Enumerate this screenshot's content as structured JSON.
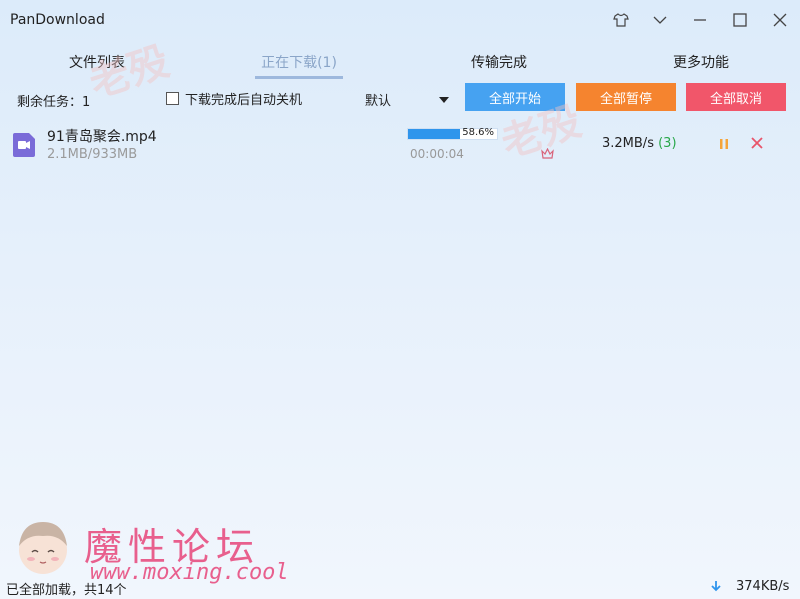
{
  "window": {
    "title": "PanDownload",
    "controls": [
      "skin-icon",
      "chevron-down-icon",
      "minimize-icon",
      "maximize-icon",
      "close-icon"
    ]
  },
  "tabs": [
    {
      "label": "文件列表",
      "active": false
    },
    {
      "label": "正在下载(1)",
      "active": true
    },
    {
      "label": "传输完成",
      "active": false
    },
    {
      "label": "更多功能",
      "active": false
    }
  ],
  "toolbar": {
    "remaining_label": "剩余任务：1",
    "auto_shutdown_label": "下载完成后自动关机",
    "auto_shutdown_checked": false,
    "sort_value": "默认",
    "start_all": "全部开始",
    "pause_all": "全部暂停",
    "cancel_all": "全部取消"
  },
  "download": {
    "file_name": "91青岛聚会.mp4",
    "size": "2.1MB/933MB",
    "progress_percent": 58.6,
    "progress_text": "58.6%",
    "elapsed": "00:00:04",
    "speed": "3.2MB/s",
    "connections": "(3)"
  },
  "status": {
    "text": "已全部加载，共14个",
    "net_speed": "374KB/s"
  },
  "watermark": {
    "text": "老殁"
  },
  "brand": {
    "name": "魔性论坛",
    "url": "www.moxing.cool"
  },
  "colors": {
    "start": "#46a2f1",
    "pause": "#f5842f",
    "cancel": "#f1566a",
    "progress": "#2f95ec",
    "brand": "#e85f8d"
  }
}
